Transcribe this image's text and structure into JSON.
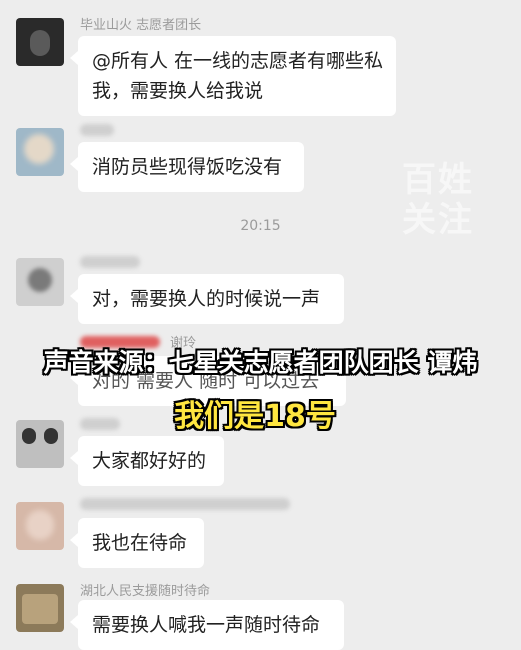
{
  "messages": [
    {
      "name": "毕业山火 志愿者团长",
      "text_lines": [
        "@所有人 在一线的志愿者有哪些私",
        "我，需要换人给我说"
      ]
    },
    {
      "name": "",
      "text_lines": [
        "消防员些现得饭吃没有"
      ]
    },
    {
      "name": "",
      "text_lines": [
        "对，需要换人的时候说一声"
      ]
    },
    {
      "name": "谢玲",
      "text_lines": [
        "对的  需要人 随时 可以过去"
      ]
    },
    {
      "name": "",
      "text_lines": [
        "大家都好好的"
      ]
    },
    {
      "name": "",
      "text_lines": [
        "我也在待命"
      ]
    },
    {
      "name": "湖北人民支援随时待命",
      "text_lines": [
        "需要换人喊我一声随时待命"
      ]
    }
  ],
  "timestamp": "20:15",
  "watermark": [
    "百姓",
    "关注"
  ],
  "caption": {
    "line1": "声音来源：七星关志愿者团队团长  谭炜",
    "line2": "我们是18号",
    "line2_color": "#ffe640"
  }
}
